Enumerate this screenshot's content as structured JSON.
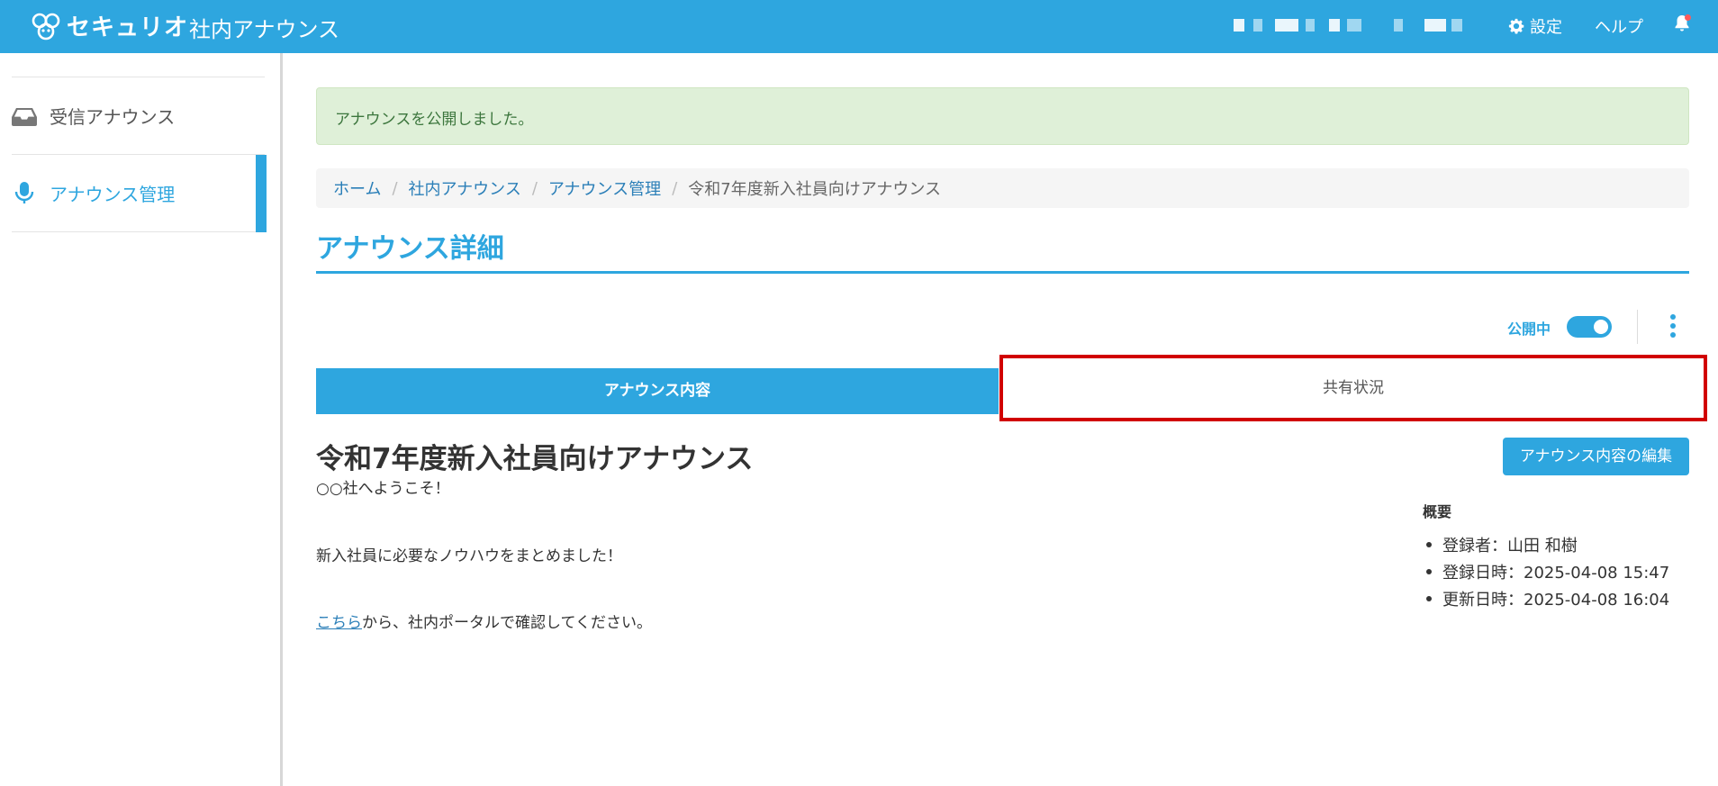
{
  "header": {
    "brand": "セキュリオ",
    "app_title": "社内アナウンス",
    "settings_label": "設定",
    "help_label": "ヘルプ"
  },
  "sidebar": {
    "items": [
      {
        "label": "受信アナウンス",
        "icon": "inbox-icon"
      },
      {
        "label": "アナウンス管理",
        "icon": "microphone-icon",
        "active": true
      }
    ]
  },
  "alert": {
    "message": "アナウンスを公開しました。"
  },
  "breadcrumb": {
    "items": [
      "ホーム",
      "社内アナウンス",
      "アナウンス管理"
    ],
    "separator": "/",
    "current": "令和7年度新入社員向けアナウンス"
  },
  "page": {
    "title": "アナウンス詳細"
  },
  "publish": {
    "label": "公開中",
    "enabled": true
  },
  "tabs": [
    {
      "label": "アナウンス内容",
      "active": true
    },
    {
      "label": "共有状況",
      "active": false
    }
  ],
  "announcement": {
    "title": "令和7年度新入社員向けアナウンス",
    "line1": "○○社へようこそ！",
    "line2": "新入社員に必要なノウハウをまとめました！",
    "link_text": "こちら",
    "line3_rest": "から、社内ポータルで確認してください。",
    "edit_button": "アナウンス内容の編集"
  },
  "summary": {
    "title": "概要",
    "items": [
      "登録者：山田 和樹",
      "登録日時：2025-04-08 15:47",
      "更新日時：2025-04-08 16:04"
    ]
  },
  "colors": {
    "accent": "#2ea6df",
    "highlight": "#d10000",
    "alert_bg": "#dff0d8"
  }
}
